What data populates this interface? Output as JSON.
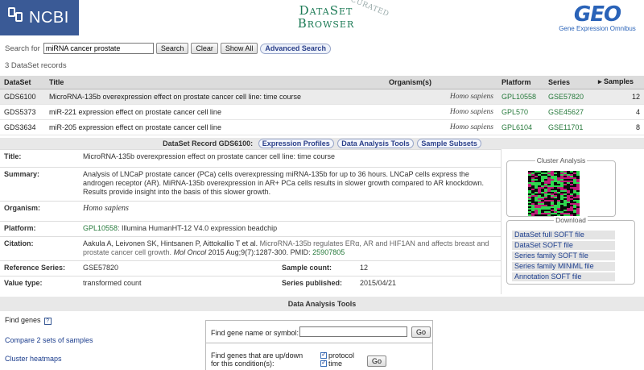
{
  "header": {
    "ncbi_label": "NCBI",
    "app_title_line1": "DataSet",
    "app_title_line2": "Browser",
    "app_title_curated": "CURATED",
    "geo_logo": "GEO",
    "geo_subtitle": "Gene Expression Omnibus"
  },
  "search": {
    "label": "Search for",
    "value": "miRNA cancer prostate",
    "search_btn": "Search",
    "clear_btn": "Clear",
    "show_all_btn": "Show All",
    "advanced_btn": "Advanced Search"
  },
  "record_count": "3 DataSet records",
  "results": {
    "columns": [
      "DataSet",
      "Title",
      "Organism(s)",
      "Platform",
      "Series",
      "▸ Samples"
    ],
    "rows": [
      {
        "dataset": "GDS6100",
        "title": "MicroRNA-135b overexpression effect on prostate cancer cell line: time course",
        "organism": "Homo sapiens",
        "platform": "GPL10558",
        "series": "GSE57820",
        "samples": "12"
      },
      {
        "dataset": "GDS5373",
        "title": "miR-221 expression effect on prostate cancer cell line",
        "organism": "Homo sapiens",
        "platform": "GPL570",
        "series": "GSE45627",
        "samples": "4"
      },
      {
        "dataset": "GDS3634",
        "title": "miR-205 expression effect on prostate cancer cell line",
        "organism": "Homo sapiens",
        "platform": "GPL6104",
        "series": "GSE11701",
        "samples": "8"
      }
    ]
  },
  "record": {
    "heading": "DataSet Record GDS6100:",
    "tab_expression": "Expression Profiles",
    "tab_analysis": "Data Analysis Tools",
    "tab_subsets": "Sample Subsets",
    "title_label": "Title:",
    "title": "MicroRNA-135b overexpression effect on prostate cancer cell line: time course",
    "summary_label": "Summary:",
    "summary": "Analysis of LNCaP prostate cancer (PCa) cells overexpressing miRNA-135b for up to 36 hours. LNCaP cells express the androgen receptor (AR). MiRNA-135b overexpression in AR+ PCa cells results in slower growth compared to AR knockdown. Results provide insight into the basis of this slower growth.",
    "organism_label": "Organism:",
    "organism": "Homo sapiens",
    "platform_label": "Platform:",
    "platform_id": "GPL10558",
    "platform_desc": ": Illumina HumanHT-12 V4.0 expression beadchip",
    "citation_label": "Citation:",
    "citation_authors": "Aakula A, Leivonen SK, Hintsanen P, Aittokallio T et al. ",
    "citation_title": "MicroRNA-135b regulates ERα, AR and HIF1AN and affects breast and prostate cancer cell growth.",
    "citation_journal": " Mol Oncol",
    "citation_rest": " 2015 Aug;9(7):1287-300. PMID: ",
    "citation_pmid": "25907805",
    "ref_series_label": "Reference Series:",
    "ref_series": "GSE57820",
    "sample_count_label": "Sample count:",
    "sample_count": "12",
    "value_type_label": "Value type:",
    "value_type": "transformed count",
    "series_published_label": "Series published:",
    "series_published": "2015/04/21"
  },
  "side": {
    "cluster_title": "Cluster Analysis",
    "download_title": "Download",
    "downloads": [
      "DataSet full SOFT file",
      "DataSet SOFT file",
      "Series family SOFT file",
      "Series family MINiML file",
      "Annotation SOFT file"
    ]
  },
  "tools": {
    "heading": "Data Analysis Tools",
    "find_genes": "Find genes",
    "help_badge": "?",
    "compare": "Compare 2 sets of samples",
    "cluster": "Cluster heatmaps",
    "gene_label": "Find gene name or symbol:",
    "go_label": "Go",
    "updown_line1": "Find genes that are up/down",
    "updown_line2": "for this condition(s):",
    "cb_protocol": "protocol",
    "cb_time": "time"
  },
  "colors": {
    "ncbi_blue": "#3a5a96",
    "link_green": "#277a3c",
    "download_link_blue": "#1a3c8c",
    "heatmap": [
      "#2fd84f",
      "#0b0b0b",
      "#c0197a"
    ]
  }
}
